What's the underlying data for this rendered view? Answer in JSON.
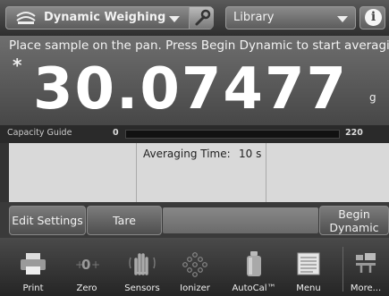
{
  "topbar": {
    "application": "Dynamic Weighing",
    "library": "Library",
    "info_glyph": "i",
    "icons": [
      "dynamic-weighing-icon",
      "wrench-icon",
      "info-icon"
    ]
  },
  "display": {
    "message": "Place sample on the pan.  Press Begin Dynamic to start averaging.",
    "stability_mark": "*",
    "weight": "30.07477",
    "unit": "g"
  },
  "capacity_guide": {
    "label": "Capacity Guide",
    "min": "0",
    "max": "220",
    "fraction": 0.0
  },
  "info_grid": {
    "averaging_time_label": "Averaging Time:",
    "averaging_time_value": "10 s"
  },
  "buttons": {
    "edit_settings": "Edit Settings",
    "tare": "Tare",
    "begin_line1": "Begin",
    "begin_line2": "Dynamic"
  },
  "nav": [
    {
      "label": "Print",
      "icon": "printer-icon"
    },
    {
      "label": "Zero",
      "icon": "zero-icon"
    },
    {
      "label": "Sensors",
      "icon": "sensors-hand-icon"
    },
    {
      "label": "Ionizer",
      "icon": "ionizer-icon"
    },
    {
      "label": "AutoCal™",
      "icon": "weight-icon"
    },
    {
      "label": "Menu",
      "icon": "menu-list-icon"
    },
    {
      "label": "More...",
      "icon": "more-icon"
    }
  ],
  "colors": {
    "background": "#333333",
    "grid": "#d9d9d9",
    "text": "#f2f2f2"
  }
}
